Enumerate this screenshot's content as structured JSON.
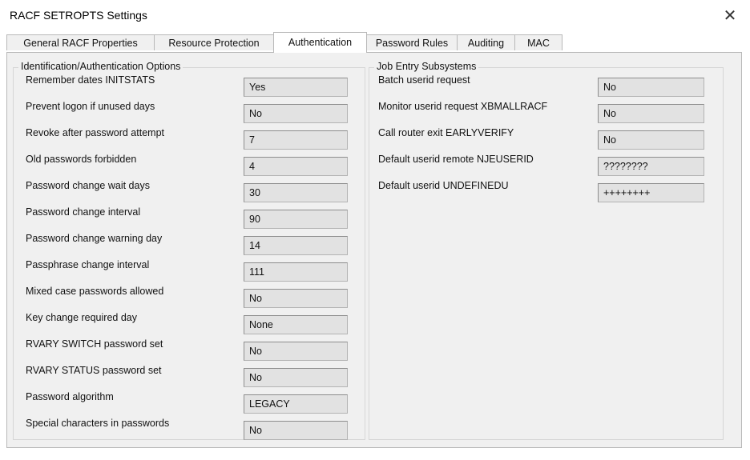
{
  "window": {
    "title": "RACF SETROPTS Settings",
    "close_glyph": "✕"
  },
  "tabs": [
    {
      "label": "General RACF Properties",
      "active": false
    },
    {
      "label": "Resource Protection",
      "active": false
    },
    {
      "label": "Authentication",
      "active": true
    },
    {
      "label": "Password Rules",
      "active": false
    },
    {
      "label": "Auditing",
      "active": false
    },
    {
      "label": "MAC",
      "active": false
    }
  ],
  "ident_auth": {
    "title": "Identification/Authentication Options",
    "rows": [
      {
        "label": "Remember dates INITSTATS",
        "value": "Yes"
      },
      {
        "label": "Prevent logon if unused days",
        "value": "No"
      },
      {
        "label": "Revoke after password attempt",
        "value": "7"
      },
      {
        "label": "Old passwords forbidden",
        "value": "4"
      },
      {
        "label": "Password change wait days",
        "value": "30"
      },
      {
        "label": "Password change interval",
        "value": "90"
      },
      {
        "label": "Password change warning day",
        "value": "14"
      },
      {
        "label": "Passphrase change interval",
        "value": "111"
      },
      {
        "label": "Mixed case passwords allowed",
        "value": "No"
      },
      {
        "label": "Key change required day",
        "value": "None"
      },
      {
        "label": "RVARY SWITCH password set",
        "value": "No"
      },
      {
        "label": "RVARY STATUS password set",
        "value": "No"
      },
      {
        "label": "Password algorithm",
        "value": "LEGACY"
      },
      {
        "label": "Special characters in passwords",
        "value": "No"
      }
    ]
  },
  "jes": {
    "title": "Job Entry Subsystems",
    "rows": [
      {
        "label": "Batch userid request",
        "value": "No"
      },
      {
        "label": "Monitor userid request XBMALLRACF",
        "value": "No"
      },
      {
        "label": "Call router exit EARLYVERIFY",
        "value": "No"
      },
      {
        "label": "Default userid remote NJEUSERID",
        "value": "????????"
      },
      {
        "label": "Default userid UNDEFINEDU",
        "value": "++++++++"
      }
    ]
  }
}
